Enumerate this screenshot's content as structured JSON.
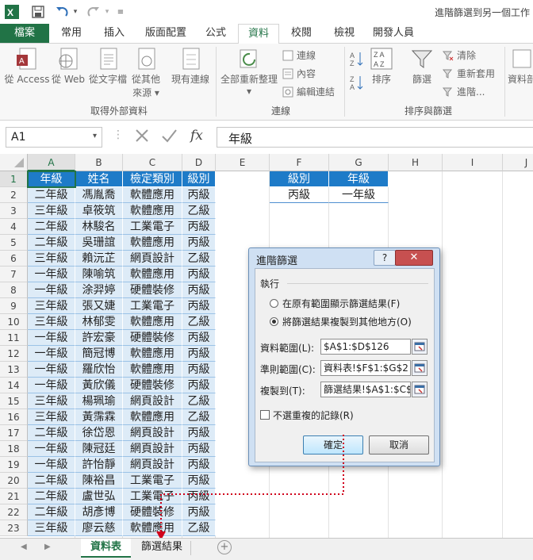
{
  "window": {
    "title": "進階篩選到另一個工作"
  },
  "tabs": [
    "檔案",
    "常用",
    "插入",
    "版面配置",
    "公式",
    "資料",
    "校閱",
    "檢視",
    "開發人員"
  ],
  "ribbon": {
    "get_external": {
      "access": "從 Access",
      "web": "從 Web",
      "text": "從文字檔",
      "other_line1": "從其他",
      "other_line2": "來源",
      "existing": "現有連線",
      "group": "取得外部資料"
    },
    "connections": {
      "refresh_all": "全部重新整理",
      "connections": "連線",
      "properties": "內容",
      "edit_links": "編輯連結",
      "group": "連線"
    },
    "sort_filter": {
      "sort": "排序",
      "filter": "篩選",
      "clear": "清除",
      "reapply": "重新套用",
      "advanced": "進階...",
      "group": "排序與篩選",
      "az": "A↓Z",
      "za": "Z↓A",
      "azbox": "ZA AZ"
    },
    "right_cut": "資料剖"
  },
  "formula_bar": {
    "name_box": "A1",
    "fx": "fx",
    "formula": "年級"
  },
  "columns": [
    "A",
    "B",
    "C",
    "D",
    "E",
    "F",
    "G",
    "H",
    "I",
    "J"
  ],
  "rows": [
    "1",
    "2",
    "3",
    "4",
    "5",
    "6",
    "7",
    "8",
    "9",
    "10",
    "11",
    "12",
    "13",
    "14",
    "15",
    "16",
    "17",
    "18",
    "19",
    "20",
    "21",
    "22",
    "23"
  ],
  "table": {
    "header": [
      "年級",
      "姓名",
      "檢定類別",
      "級別"
    ],
    "data": [
      [
        "二年級",
        "馮胤喬",
        "軟體應用",
        "丙級"
      ],
      [
        "三年級",
        "卓筱筑",
        "軟體應用",
        "乙級"
      ],
      [
        "二年級",
        "林駿名",
        "工業電子",
        "丙級"
      ],
      [
        "二年級",
        "吳珊誼",
        "軟體應用",
        "丙級"
      ],
      [
        "三年級",
        "賴沅芷",
        "網頁設計",
        "乙級"
      ],
      [
        "一年級",
        "陳喻筑",
        "軟體應用",
        "丙級"
      ],
      [
        "一年級",
        "涂羿婷",
        "硬體裝修",
        "丙級"
      ],
      [
        "三年級",
        "張又婕",
        "工業電子",
        "丙級"
      ],
      [
        "三年級",
        "林郁雯",
        "軟體應用",
        "乙級"
      ],
      [
        "一年級",
        "許宏豪",
        "硬體裝修",
        "丙級"
      ],
      [
        "一年級",
        "簡冠博",
        "軟體應用",
        "丙級"
      ],
      [
        "一年級",
        "羅欣怡",
        "軟體應用",
        "丙級"
      ],
      [
        "一年級",
        "黃欣儀",
        "硬體裝修",
        "丙級"
      ],
      [
        "三年級",
        "楊珮瑜",
        "網頁設計",
        "乙級"
      ],
      [
        "三年級",
        "黃霈霖",
        "軟體應用",
        "乙級"
      ],
      [
        "二年級",
        "徐岱恩",
        "網頁設計",
        "丙級"
      ],
      [
        "一年級",
        "陳冠廷",
        "網頁設計",
        "丙級"
      ],
      [
        "一年級",
        "許怡靜",
        "網頁設計",
        "丙級"
      ],
      [
        "二年級",
        "陳裕昌",
        "工業電子",
        "丙級"
      ],
      [
        "二年級",
        "盧世弘",
        "工業電子",
        "丙級"
      ],
      [
        "二年級",
        "胡彥博",
        "硬體裝修",
        "丙級"
      ],
      [
        "三年級",
        "廖云慈",
        "軟體應用",
        "乙級"
      ]
    ]
  },
  "criteria": {
    "header": [
      "級別",
      "年級"
    ],
    "row": [
      "丙級",
      "一年級"
    ]
  },
  "dialog": {
    "title": "進階篩選",
    "help": "?",
    "close": "✕",
    "action_label": "執行",
    "option1": "在原有範圍顯示篩選結果(F)",
    "option2": "將篩選結果複製到其他地方(O)",
    "list_range_label": "資料範圍(L):",
    "list_range": "$A$1:$D$126",
    "criteria_label": "準則範圍(C):",
    "criteria_range": "資料表!$F$1:$G$2",
    "copy_to_label": "複製到(T):",
    "copy_to": "篩選結果!$A$1:$C$",
    "unique_label": "不選重複的記錄(R)",
    "ok": "確定",
    "cancel": "取消"
  },
  "sheets": [
    "資料表",
    "篩選結果"
  ],
  "colors": {
    "accent": "#217346",
    "table_header": "#1e7bc8",
    "table_band": "#ddebf7",
    "arrow": "#d0021b"
  }
}
